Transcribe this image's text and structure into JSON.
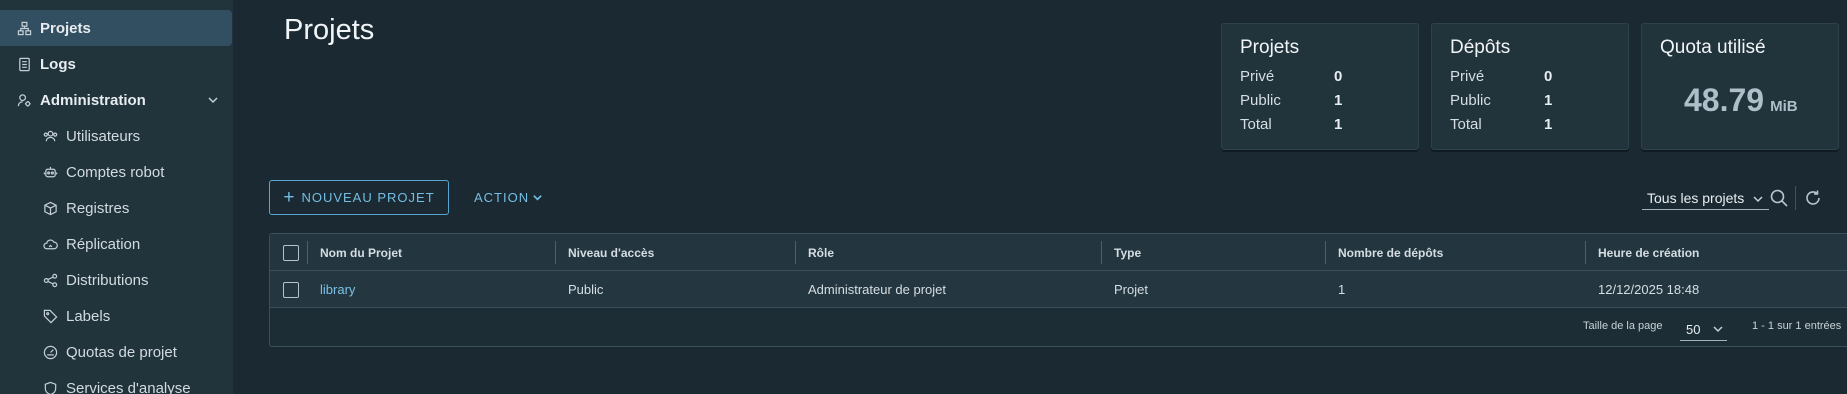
{
  "sidebar": {
    "items": [
      {
        "label": "Projets",
        "icon": "projects-icon",
        "active": true
      },
      {
        "label": "Logs",
        "icon": "logs-icon"
      },
      {
        "label": "Administration",
        "icon": "admin-icon",
        "expanded": true
      },
      {
        "label": "Utilisateurs",
        "icon": "users-icon"
      },
      {
        "label": "Comptes robot",
        "icon": "robot-icon"
      },
      {
        "label": "Registres",
        "icon": "registry-icon"
      },
      {
        "label": "Réplication",
        "icon": "replication-icon"
      },
      {
        "label": "Distributions",
        "icon": "distributions-icon"
      },
      {
        "label": "Labels",
        "icon": "label-icon"
      },
      {
        "label": "Quotas de projet",
        "icon": "quota-icon"
      },
      {
        "label": "Services d'analyse",
        "icon": "scanner-icon"
      }
    ]
  },
  "header": {
    "title": "Projets"
  },
  "cards": {
    "projects": {
      "title": "Projets",
      "private_label": "Privé",
      "private": "0",
      "public_label": "Public",
      "public": "1",
      "total_label": "Total",
      "total": "1"
    },
    "repos": {
      "title": "Dépôts",
      "private_label": "Privé",
      "private": "0",
      "public_label": "Public",
      "public": "1",
      "total_label": "Total",
      "total": "1"
    },
    "quota": {
      "title": "Quota utilisé",
      "value": "48.79",
      "unit": "MiB"
    }
  },
  "toolbar": {
    "new_project": "NOUVEAU PROJET",
    "action": "ACTION",
    "filter": "Tous les projets"
  },
  "table": {
    "columns": [
      "Nom du Projet",
      "Niveau d'accès",
      "Rôle",
      "Type",
      "Nombre de dépôts",
      "Heure de création"
    ],
    "rows": [
      {
        "name": "library",
        "access": "Public",
        "role": "Administrateur de projet",
        "type": "Projet",
        "repo_count": "1",
        "created": "12/12/2025 18:48"
      }
    ],
    "footer": {
      "page_size_label": "Taille de la page",
      "page_size": "50",
      "range": "1 - 1 sur 1 entrées"
    }
  },
  "colors": {
    "accent": "#74bde3",
    "sidebar_bg": "#21333b",
    "body_bg": "#1b2a32",
    "active_bg": "#324f61"
  }
}
